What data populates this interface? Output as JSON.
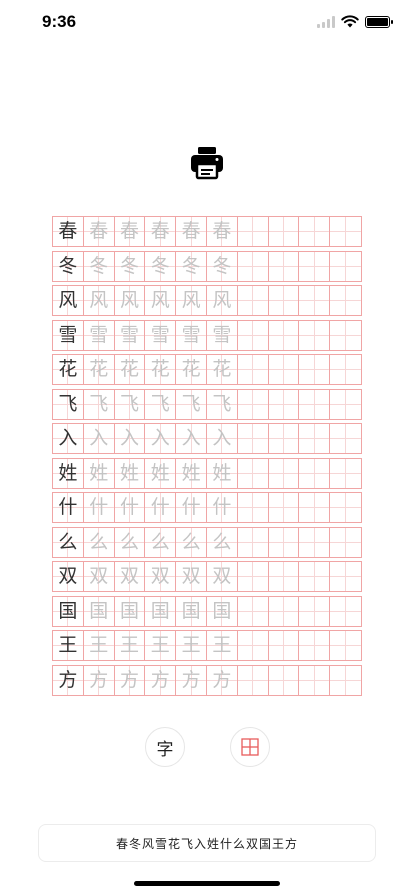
{
  "status_bar": {
    "time": "9:36"
  },
  "icons": {
    "printer": "printer-icon",
    "wifi": "wifi-icon",
    "signal": "signal-icon",
    "battery": "battery-icon",
    "grid_style": "tianzige-grid-icon"
  },
  "colors": {
    "grid_line": "#f0a5a5",
    "grid_guide": "#f6d6d6",
    "model_char": "#333333",
    "trace_char": "#c4c4c4"
  },
  "practice": {
    "characters": [
      "春",
      "冬",
      "风",
      "雪",
      "花",
      "飞",
      "入",
      "姓",
      "什",
      "么",
      "双",
      "国",
      "王",
      "方"
    ],
    "trace_count": 5,
    "blank_count": 4
  },
  "toolbar": {
    "font_label": "字"
  },
  "input": {
    "text": "春冬风雪花飞入姓什么双国王方"
  }
}
